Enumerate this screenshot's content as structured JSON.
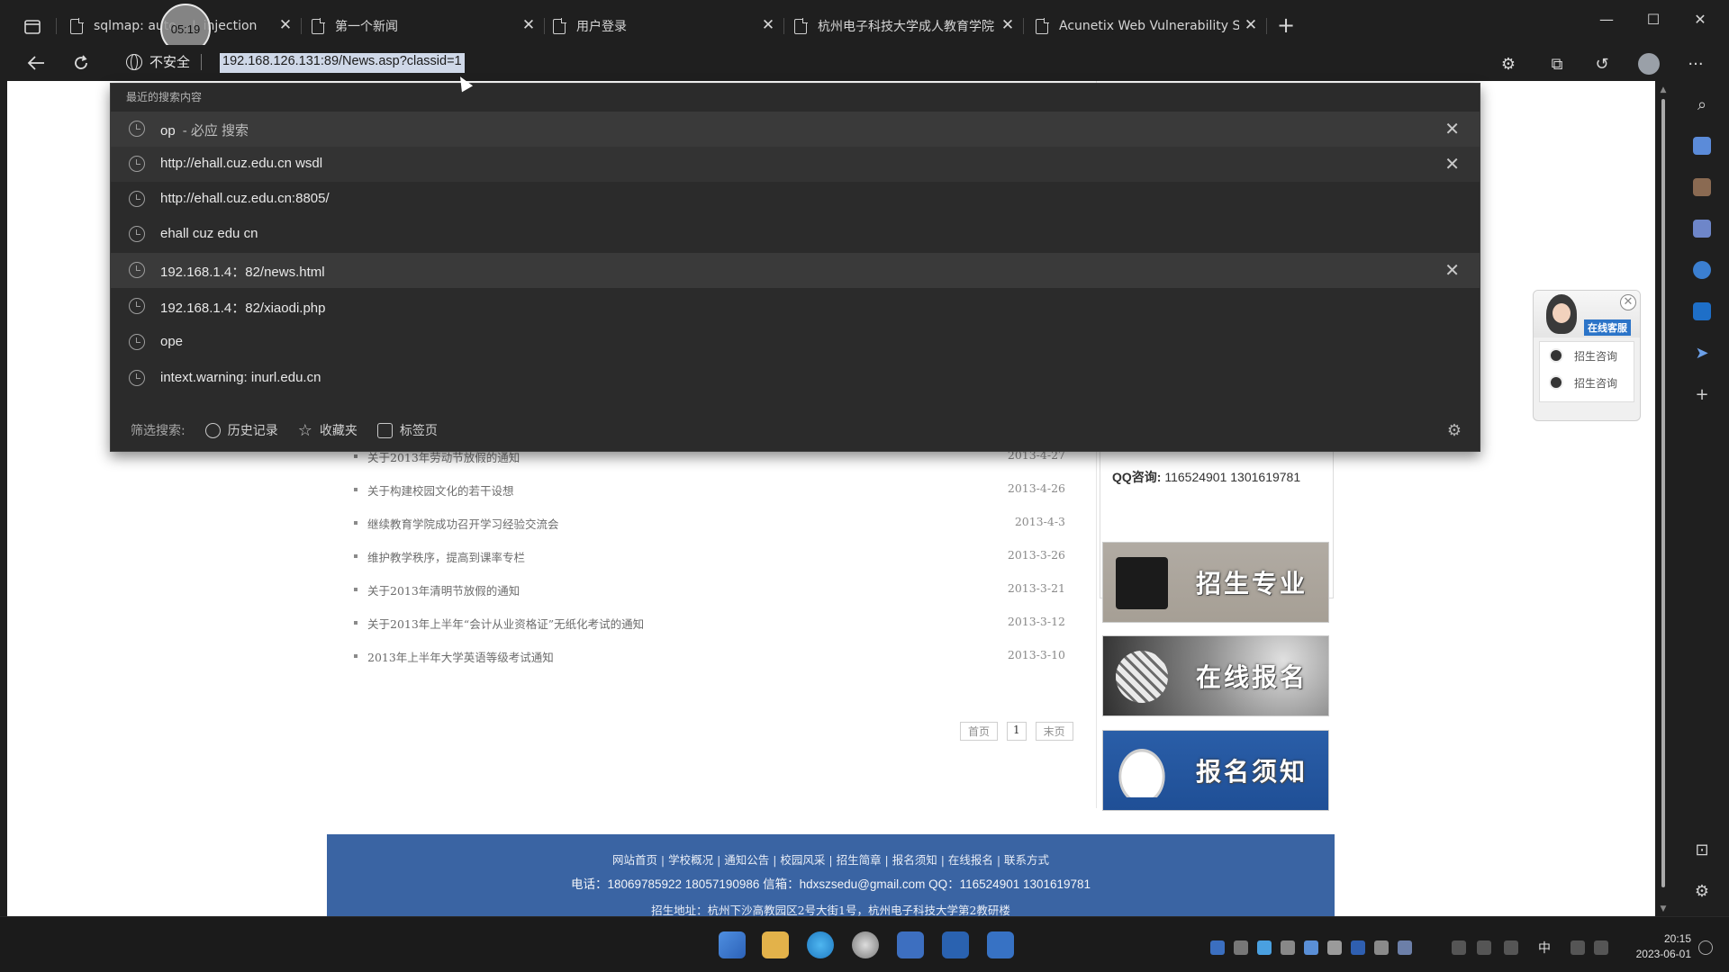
{
  "browser": {
    "timer_overlay": "05:19",
    "tabs": [
      {
        "label": "sqlmap: auto... L injection",
        "closable": true
      },
      {
        "label": "第一个新闻",
        "closable": true
      },
      {
        "label": "用户登录",
        "closable": true
      },
      {
        "label": "杭州电子科技大学成人教育学院",
        "closable": true
      },
      {
        "label": "Acunetix Web Vulnerability Scar",
        "closable": true
      }
    ],
    "security_label": "不安全",
    "url": "192.168.126.131:89/News.asp?classid=1"
  },
  "dropdown": {
    "header": "最近的搜索内容",
    "items": [
      {
        "text": "op",
        "suffix": "- 必应 搜索",
        "removable": true
      },
      {
        "text": "http://ehall.cuz.edu.cn wsdl",
        "suffix": "",
        "removable": true
      },
      {
        "text": "http://ehall.cuz.edu.cn:8805/",
        "suffix": "",
        "removable": false
      },
      {
        "text": "ehall cuz edu cn",
        "suffix": "",
        "removable": false
      },
      {
        "text": "192.168.1.4：82/news.html",
        "suffix": "",
        "removable": true
      },
      {
        "text": "192.168.1.4：82/xiaodi.php",
        "suffix": "",
        "removable": false
      },
      {
        "text": "ope",
        "suffix": "",
        "removable": false
      },
      {
        "text": "intext.warning: inurl.edu.cn",
        "suffix": "",
        "removable": false
      }
    ],
    "footer": {
      "filter_label": "筛选搜索:",
      "history": "历史记录",
      "favorites": "收藏夹",
      "tabs": "标签页"
    }
  },
  "page": {
    "news": [
      {
        "title": "关于2013年劳动节放假的通知",
        "date": "2013-4-27"
      },
      {
        "title": "关于构建校园文化的若干设想",
        "date": "2013-4-26"
      },
      {
        "title": "继续教育学院成功召开学习经验交流会",
        "date": "2013-4-3"
      },
      {
        "title": "维护教学秩序，提高到课率专栏",
        "date": "2013-3-26"
      },
      {
        "title": "关于2013年清明节放假的通知",
        "date": "2013-3-21"
      },
      {
        "title": "关于2013年上半年“会计从业资格证”无纸化考试的通知",
        "date": "2013-3-12"
      },
      {
        "title": "2013年上半年大学英语等级考试通知",
        "date": "2013-3-10"
      }
    ],
    "pager": {
      "first": "首页",
      "current": "1",
      "last": "末页"
    },
    "qq_label": "QQ咨询:",
    "qq_value": "116524901 1301619781",
    "banners": [
      "招生专业",
      "在线报名",
      "报名须知"
    ],
    "online_service": {
      "tag": "在线客服",
      "items": [
        "招生咨询",
        "招生咨询"
      ]
    },
    "footer": {
      "links": "网站首页 | 学校概况 | 通知公告 | 校园风采 | 招生简章 | 报名须知 | 在线报名 | 联系方式",
      "contact": "电话：18069785922 18057190986  信箱：hdxszsedu@gmail.com  QQ：116524901 1301619781",
      "address": "招生地址：杭州下沙高教园区2号大街1号，杭州电子科技大学第2教研楼"
    }
  },
  "taskbar": {
    "ime": "中",
    "time": "20:15",
    "date": "2023-06-01"
  },
  "colors": {
    "browser_bg": "#1f1f1f",
    "dropdown_bg": "#2b2b2b",
    "url_highlight": "#cfd8e8",
    "footer_blue": "#3a64a3"
  }
}
